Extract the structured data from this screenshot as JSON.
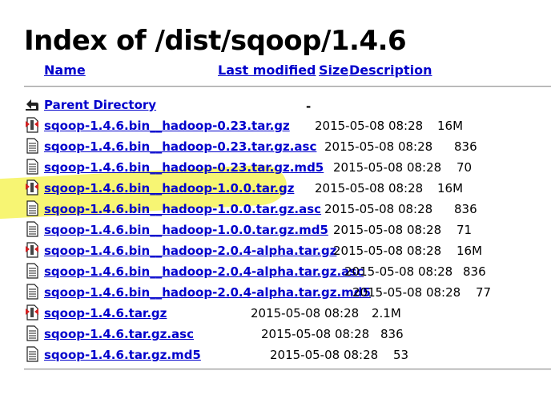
{
  "title": "Index of /dist/sqoop/1.4.6",
  "headers": {
    "name": "Name",
    "last_modified": "Last modified",
    "size": "Size",
    "description": "Description"
  },
  "parent": {
    "label": "Parent Directory",
    "size": "-"
  },
  "files": [
    {
      "name": "sqoop-1.4.6.bin__hadoop-0.23.tar.gz",
      "date": "2015-05-08 08:28",
      "size": "16M",
      "icon": "archive-icon"
    },
    {
      "name": "sqoop-1.4.6.bin__hadoop-0.23.tar.gz.asc",
      "date": "2015-05-08 08:28",
      "size": "836",
      "icon": "text-file-icon"
    },
    {
      "name": "sqoop-1.4.6.bin__hadoop-0.23.tar.gz.md5",
      "date": "2015-05-08 08:28",
      "size": "70",
      "icon": "text-file-icon"
    },
    {
      "name": "sqoop-1.4.6.bin__hadoop-1.0.0.tar.gz",
      "date": "2015-05-08 08:28",
      "size": "16M",
      "icon": "archive-icon"
    },
    {
      "name": "sqoop-1.4.6.bin__hadoop-1.0.0.tar.gz.asc",
      "date": "2015-05-08 08:28",
      "size": "836",
      "icon": "text-file-icon"
    },
    {
      "name": "sqoop-1.4.6.bin__hadoop-1.0.0.tar.gz.md5",
      "date": "2015-05-08 08:28",
      "size": "71",
      "icon": "text-file-icon"
    },
    {
      "name": "sqoop-1.4.6.bin__hadoop-2.0.4-alpha.tar.gz",
      "date": "2015-05-08 08:28",
      "size": "16M",
      "icon": "archive-icon"
    },
    {
      "name": "sqoop-1.4.6.bin__hadoop-2.0.4-alpha.tar.gz.asc",
      "date": "2015-05-08 08:28",
      "size": "836",
      "icon": "text-file-icon"
    },
    {
      "name": "sqoop-1.4.6.bin__hadoop-2.0.4-alpha.tar.gz.md5",
      "date": "2015-05-08 08:28",
      "size": "77",
      "icon": "text-file-icon"
    },
    {
      "name": "sqoop-1.4.6.tar.gz",
      "date": "2015-05-08 08:28",
      "size": "2.1M",
      "icon": "archive-icon"
    },
    {
      "name": "sqoop-1.4.6.tar.gz.asc",
      "date": "2015-05-08 08:28",
      "size": "836",
      "icon": "text-file-icon"
    },
    {
      "name": "sqoop-1.4.6.tar.gz.md5",
      "date": "2015-05-08 08:28",
      "size": "53",
      "icon": "text-file-icon"
    }
  ],
  "highlight_color": "#f6f35a",
  "link_color": "#0000cc"
}
